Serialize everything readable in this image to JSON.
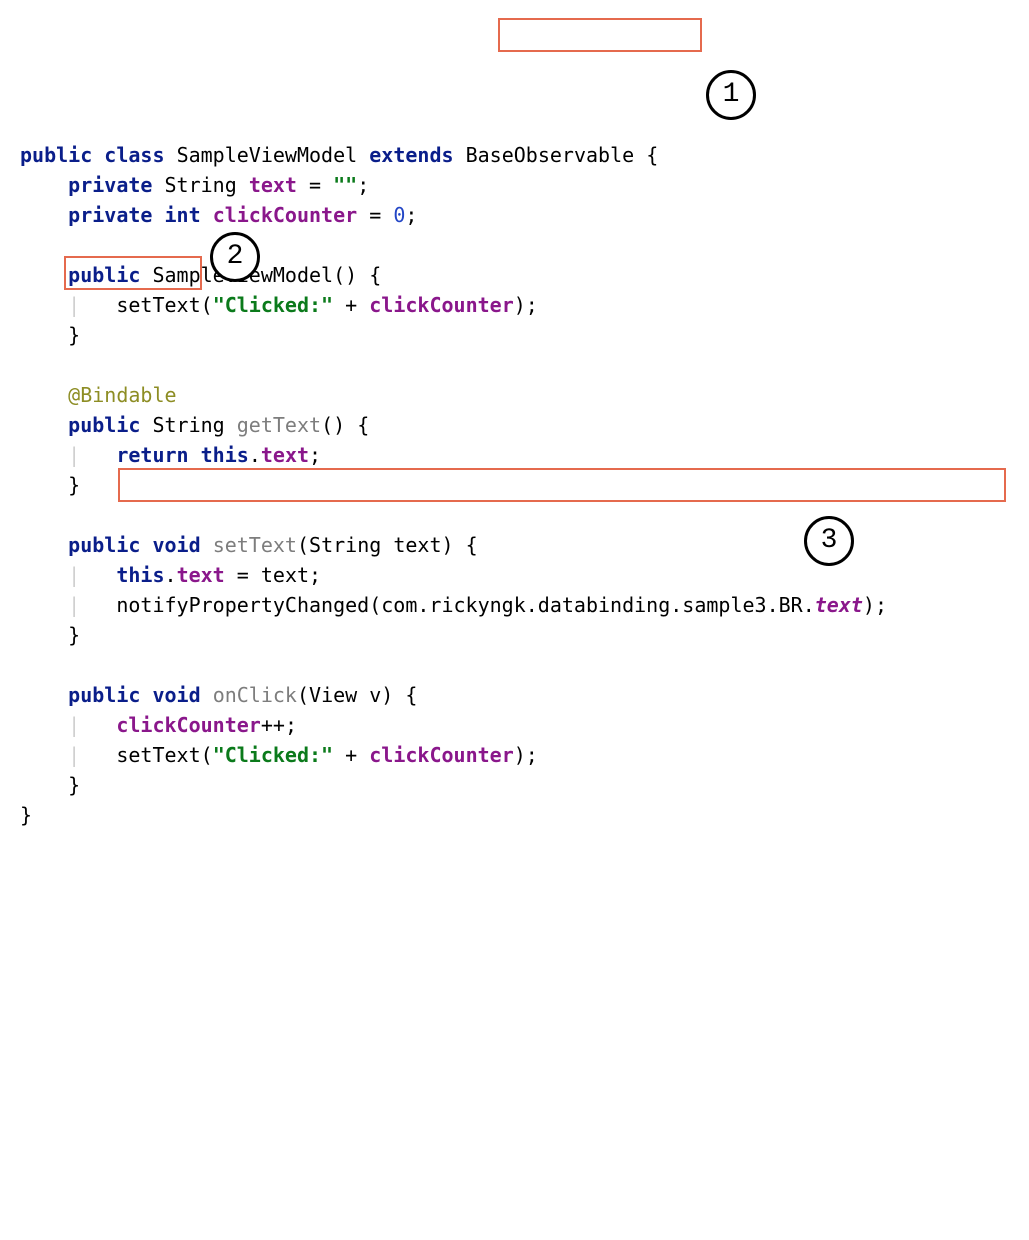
{
  "annotations": {
    "circle1": "1",
    "circle2": "2",
    "circle3": "3"
  },
  "tokens": {
    "kw_public": "public",
    "kw_class": "class",
    "kw_extends": "extends",
    "kw_private": "private",
    "kw_int": "int",
    "kw_void": "void",
    "kw_return": "return",
    "kw_this": "this",
    "cls_name": "SampleViewModel",
    "base_cls": "BaseObservable",
    "type_string": "String",
    "type_view": "View",
    "field_text": "text",
    "field_clickCounter": "clickCounter",
    "str_empty": "\"\"",
    "num_zero": "0",
    "ctor": "SampleViewModel",
    "str_clicked": "\"Clicked:\"",
    "ann_bindable": "@Bindable",
    "m_getText": "getText",
    "m_setText": "setText",
    "m_onClick": "onClick",
    "call_notify": "notifyPropertyChanged",
    "pkg_path": "com.rickyngk.databinding.sample3.BR.",
    "br_text": "text",
    "param_text": "text",
    "param_v": "v",
    "op_eq": "=",
    "op_inc": "++",
    "op_plus": "+",
    "semi": ";",
    "lbrace": "{",
    "rbrace": "}",
    "lparen": "(",
    "rparen": ")",
    "dot": ".",
    "bar": "|"
  }
}
